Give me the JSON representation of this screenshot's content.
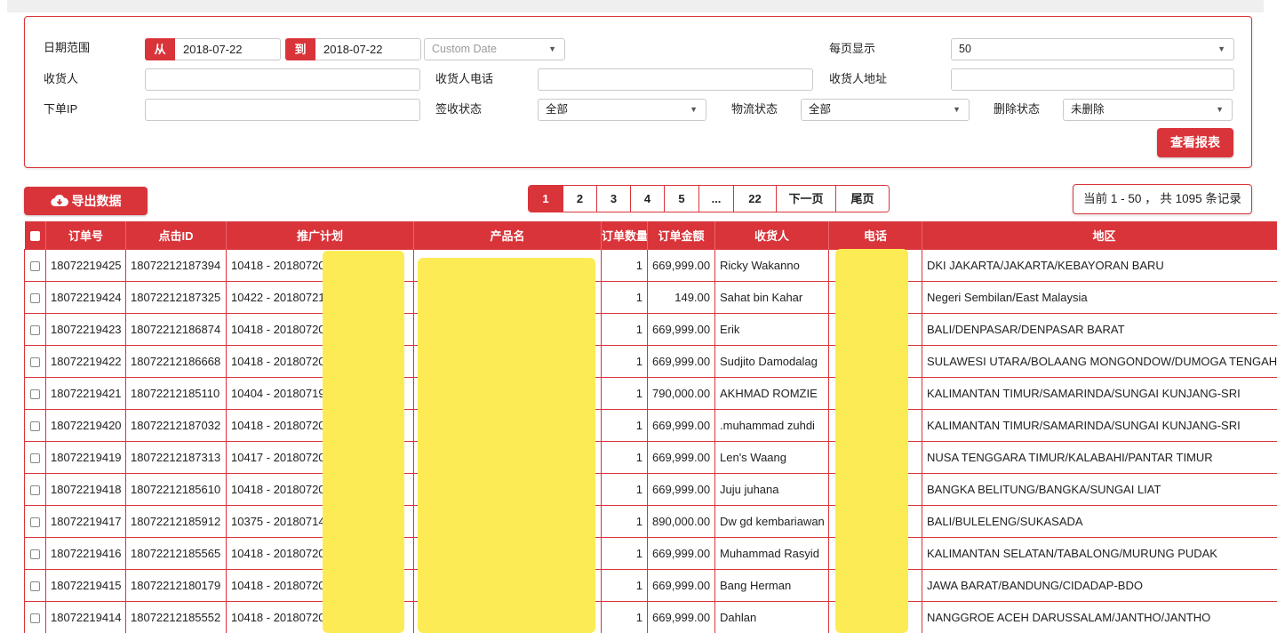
{
  "filters": {
    "date_range_label": "日期范围",
    "from_tag": "从",
    "from_value": "2018-07-22",
    "to_tag": "到",
    "to_value": "2018-07-22",
    "custom_date_placeholder": "Custom Date",
    "per_page_label": "每页显示",
    "per_page_value": "50",
    "receiver_label": "收货人",
    "receiver_phone_label": "收货人电话",
    "receiver_address_label": "收货人地址",
    "order_ip_label": "下单IP",
    "sign_status_label": "签收状态",
    "sign_status_value": "全部",
    "logistics_status_label": "物流状态",
    "logistics_status_value": "全部",
    "delete_status_label": "删除状态",
    "delete_status_value": "未删除",
    "view_report_button": "查看报表"
  },
  "toolbar": {
    "export_button": "导出数据",
    "pages": [
      "1",
      "2",
      "3",
      "4",
      "5",
      "...",
      "22",
      "下一页",
      "尾页"
    ],
    "active_page": "1",
    "record_count": "当前 1 - 50 ， 共 1095 条记录"
  },
  "table": {
    "headers": [
      "订单号",
      "点击ID",
      "推广计划",
      "产品名",
      "订单数量",
      "订单金额",
      "收货人",
      "电话",
      "地区"
    ],
    "rows": [
      {
        "order_id": "18072219425",
        "click_id": "18072212187394",
        "campaign": "10418 - 20180720-",
        "product": "",
        "qty": "1",
        "amount": "669,999.00",
        "receiver": "Ricky Wakanno",
        "phone": "",
        "region": "DKI JAKARTA/JAKARTA/KEBAYORAN BARU"
      },
      {
        "order_id": "18072219424",
        "click_id": "18072212187325",
        "campaign": "10422 - 20180721",
        "product": "",
        "qty": "1",
        "amount": "149.00",
        "receiver": "Sahat bin Kahar",
        "phone": "",
        "region": "Negeri Sembilan/East Malaysia"
      },
      {
        "order_id": "18072219423",
        "click_id": "18072212186874",
        "campaign": "10418 - 20180720-",
        "product": "",
        "qty": "1",
        "amount": "669,999.00",
        "receiver": "Erik",
        "phone": "",
        "region": "BALI/DENPASAR/DENPASAR BARAT"
      },
      {
        "order_id": "18072219422",
        "click_id": "18072212186668",
        "campaign": "10418 - 20180720-",
        "product": "",
        "qty": "1",
        "amount": "669,999.00",
        "receiver": "Sudjito Damodalag",
        "phone": "",
        "region": "SULAWESI UTARA/BOLAANG MONGONDOW/DUMOGA TENGAH"
      },
      {
        "order_id": "18072219421",
        "click_id": "18072212185110",
        "campaign": "10404 - 20180719-",
        "product": "",
        "qty": "1",
        "amount": "790,000.00",
        "receiver": "AKHMAD ROMZIE",
        "phone": "",
        "region": "KALIMANTAN TIMUR/SAMARINDA/SUNGAI KUNJANG-SRI"
      },
      {
        "order_id": "18072219420",
        "click_id": "18072212187032",
        "campaign": "10418 - 20180720-",
        "product": "",
        "qty": "1",
        "amount": "669,999.00",
        "receiver": ".muhammad zuhdi",
        "phone": "",
        "region": "KALIMANTAN TIMUR/SAMARINDA/SUNGAI KUNJANG-SRI"
      },
      {
        "order_id": "18072219419",
        "click_id": "18072212187313",
        "campaign": "10417 - 20180720-",
        "product": "",
        "qty": "1",
        "amount": "669,999.00",
        "receiver": "Len's Waang",
        "phone": "",
        "region": "NUSA TENGGARA TIMUR/KALABAHI/PANTAR TIMUR"
      },
      {
        "order_id": "18072219418",
        "click_id": "18072212185610",
        "campaign": "10418 - 20180720-",
        "product": "",
        "qty": "1",
        "amount": "669,999.00",
        "receiver": "Juju juhana",
        "phone": "",
        "region": "BANGKA BELITUNG/BANGKA/SUNGAI LIAT"
      },
      {
        "order_id": "18072219417",
        "click_id": "18072212185912",
        "campaign": "10375 - 20180714-",
        "product": "",
        "qty": "1",
        "amount": "890,000.00",
        "receiver": "Dw gd kembariawan",
        "phone": "",
        "region": "BALI/BULELENG/SUKASADA"
      },
      {
        "order_id": "18072219416",
        "click_id": "18072212185565",
        "campaign": "10418 - 20180720-",
        "product": "",
        "qty": "1",
        "amount": "669,999.00",
        "receiver": "Muhammad Rasyid",
        "phone": "",
        "region": "KALIMANTAN SELATAN/TABALONG/MURUNG PUDAK"
      },
      {
        "order_id": "18072219415",
        "click_id": "18072212180179",
        "campaign": "10418 - 20180720-",
        "product": "",
        "qty": "1",
        "amount": "669,999.00",
        "receiver": "Bang Herman",
        "phone": "",
        "region": "JAWA BARAT/BANDUNG/CIDADAP-BDO"
      },
      {
        "order_id": "18072219414",
        "click_id": "18072212185552",
        "campaign": "10418 - 20180720-",
        "product": "",
        "qty": "1",
        "amount": "669,999.00",
        "receiver": "Dahlan",
        "phone": "",
        "region": "NANGGROE ACEH DARUSSALAM/JANTHO/JANTHO"
      }
    ]
  },
  "colors": {
    "accent": "#d9343a",
    "mask": "#fdeb55"
  },
  "icons": {
    "export": "cloud-download-icon",
    "dropdown": "caret-down-icon"
  }
}
